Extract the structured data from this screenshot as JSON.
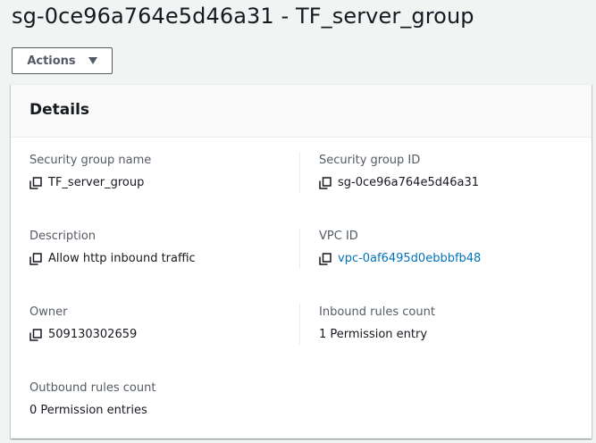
{
  "page": {
    "title": "sg-0ce96a764e5d46a31 - TF_server_group"
  },
  "toolbar": {
    "actions_label": "Actions"
  },
  "details": {
    "title": "Details",
    "security_group_name": {
      "label": "Security group name",
      "value": "TF_server_group"
    },
    "security_group_id": {
      "label": "Security group ID",
      "value": "sg-0ce96a764e5d46a31"
    },
    "description": {
      "label": "Description",
      "value": "Allow http inbound traffic"
    },
    "vpc_id": {
      "label": "VPC ID",
      "value": "vpc-0af6495d0ebbbfb48"
    },
    "owner": {
      "label": "Owner",
      "value": "509130302659"
    },
    "inbound_rules_count": {
      "label": "Inbound rules count",
      "value": "1 Permission entry"
    },
    "outbound_rules_count": {
      "label": "Outbound rules count",
      "value": "0 Permission entries"
    }
  },
  "colors": {
    "link": "#0073bb",
    "label": "#545b64",
    "text": "#16191f",
    "background": "#f2f3f3"
  },
  "icons": {
    "copy": "copy-icon",
    "dropdown": "caret-down-icon"
  }
}
